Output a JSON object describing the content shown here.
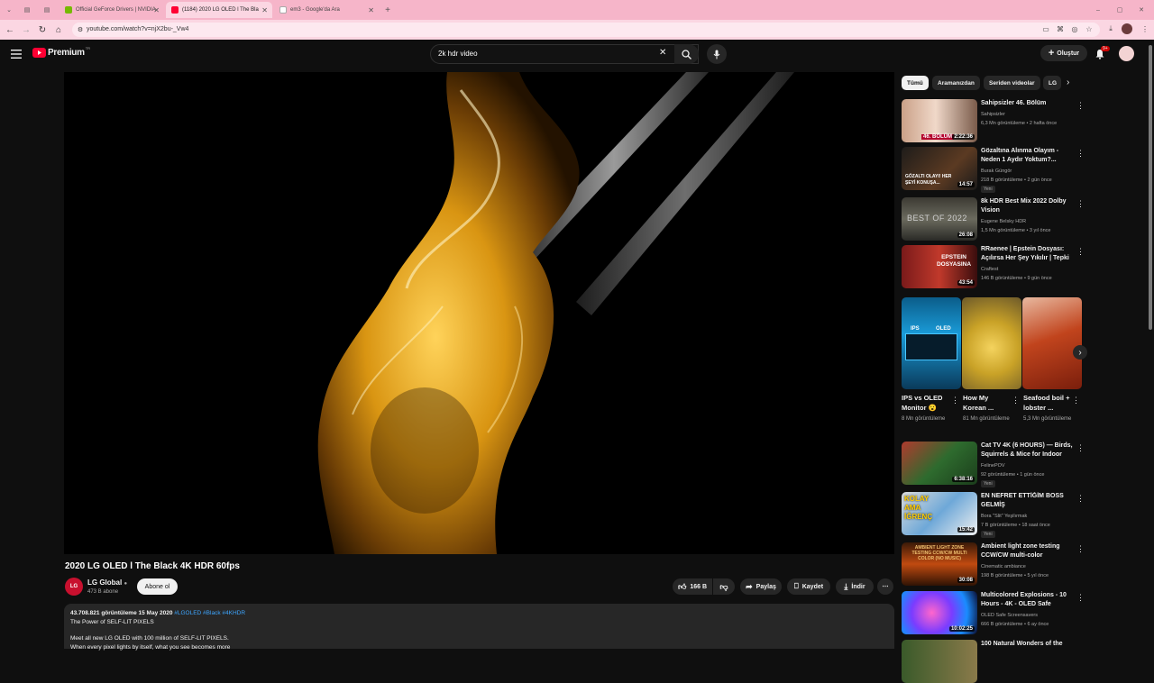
{
  "browser": {
    "tabs": [
      {
        "label": "Official GeForce Drivers | NVIDIA"
      },
      {
        "label": "(1184) 2020 LG OLED l The Bla"
      },
      {
        "label": "em3 - Google'da Ara"
      }
    ],
    "url": "youtube.com/watch?v=njX2bu-_Vw4"
  },
  "header": {
    "logo_text": "Premium",
    "logo_super": "TR",
    "search_value": "2k hdr video",
    "create_label": "Oluştur",
    "notif_count": "9+"
  },
  "video": {
    "title": "2020 LG OLED l The Black 4K HDR 60fps",
    "channel": "LG Global",
    "channel_avatar_text": "LG",
    "subscribers": "473 B abone",
    "subscribe_label": "Abone ol",
    "likes": "166 B",
    "share_label": "Paylaş",
    "save_label": "Kaydet",
    "download_label": "İndir"
  },
  "description": {
    "views_date": "43.708.821 görüntüleme  15 May 2020",
    "tags": "#LGOLED #Black #4KHDR",
    "line1": "The Power of SELF-LIT PIXELS",
    "line2": "Meet all new LG OLED with 100 million of SELF-LIT PIXELS.",
    "line3": "When every pixel lights by itself, what you see becomes more"
  },
  "chips": [
    "Tümü",
    "Aramanızdan",
    "Seriden videolar",
    "LG"
  ],
  "recs_top": [
    {
      "title": "Sahipsizler 46. Bölüm",
      "channel": "Sahipsizler",
      "meta": "6,3 Mn görüntüleme • 2 hafta önce",
      "duration": "2:22:36",
      "thumb_text": "46. BÖLÜM",
      "is_new": ""
    },
    {
      "title": "Gözaltına Alınma Olayım - Neden 1 Aydır Yoktum?...",
      "channel": "Burak Güngör",
      "meta": "218 B görüntüleme • 2 gün önce",
      "duration": "14:57",
      "thumb_text": "GÖZALTI OLAYI! HER ŞEYİ KONUŞA...",
      "is_new": "Yeni"
    },
    {
      "title": "8k HDR Best Mix 2022 Dolby Vision",
      "channel": "Eugene Belsky HDR",
      "meta": "1,5 Mn görüntüleme • 3 yıl önce",
      "duration": "26:08",
      "thumb_text": "BEST OF 2022",
      "is_new": ""
    },
    {
      "title": "RRaenee | Epstein Dosyası: Açılırsa Her Şey Yıkılır | Tepki |...",
      "channel": "Craftest",
      "meta": "146 B görüntüleme • 9 gün önce",
      "duration": "43:54",
      "thumb_text": "EPSTEIN DOSYASINA",
      "is_new": ""
    }
  ],
  "shorts": [
    {
      "title": "IPS vs OLED Monitor 😮",
      "views": "8 Mn görüntüleme",
      "thumb_a": "IPS",
      "thumb_b": "OLED"
    },
    {
      "title": "How My Korean ...",
      "views": "81 Mn görüntüleme"
    },
    {
      "title": "Seafood boil + lobster ...",
      "views": "5,3 Mn görüntüleme"
    }
  ],
  "recs_bottom": [
    {
      "title": "Cat TV 4K (6 HOURS) — Birds, Squirrels & Mice for Indoor Ca...",
      "channel": "FelinePOV",
      "meta": "92 görüntüleme • 1 gün önce",
      "duration": "6:38:16",
      "thumb_text": "",
      "is_new": "Yeni"
    },
    {
      "title": "EN NEFRET ETTİĞİM BOSS GELMİŞ",
      "channel": "Bora \"Slit\" Yeşilırmak",
      "meta": "7 B görüntüleme • 18 saat önce",
      "duration": "15:42",
      "thumb_text": "KOLAY AMA İĞRENÇ",
      "is_new": "Yeni"
    },
    {
      "title": "Ambient light zone testing CCW/CW multi-color",
      "channel": "Cinematic ambiance",
      "meta": "198 B görüntüleme • 5 yıl önce",
      "duration": "30:08",
      "thumb_text": "AMBIENT LIGHT ZONE TESTING CCW/CW MULTI COLOR (NO MUSIC)",
      "is_new": ""
    },
    {
      "title": "Multicolored Explosions - 10 Hours - 4K - OLED Safe",
      "channel": "OLED Safe Screensavers",
      "meta": "666 B görüntüleme • 6 ay önce",
      "duration": "10:02:25",
      "thumb_text": "",
      "is_new": ""
    },
    {
      "title": "100 Natural Wonders of the",
      "channel": "",
      "meta": "",
      "duration": "",
      "thumb_text": "",
      "is_new": ""
    }
  ]
}
